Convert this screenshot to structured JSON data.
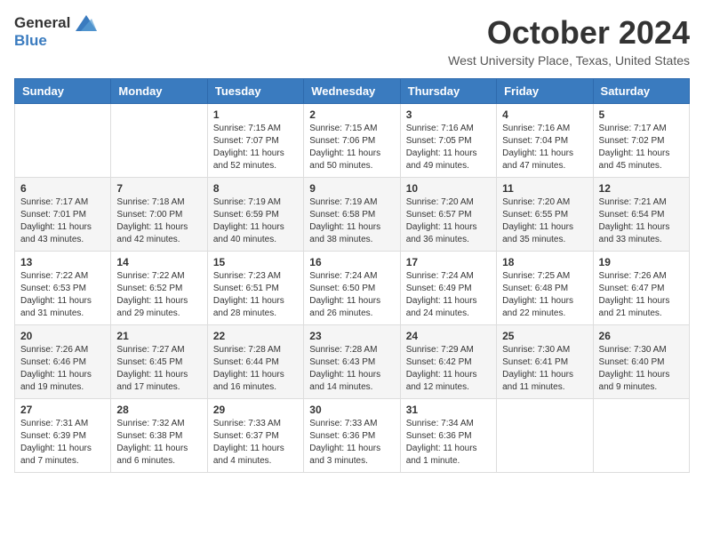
{
  "logo": {
    "general": "General",
    "blue": "Blue"
  },
  "title": "October 2024",
  "location": "West University Place, Texas, United States",
  "days_of_week": [
    "Sunday",
    "Monday",
    "Tuesday",
    "Wednesday",
    "Thursday",
    "Friday",
    "Saturday"
  ],
  "weeks": [
    [
      {
        "day": "",
        "info": ""
      },
      {
        "day": "",
        "info": ""
      },
      {
        "day": "1",
        "info": "Sunrise: 7:15 AM\nSunset: 7:07 PM\nDaylight: 11 hours and 52 minutes."
      },
      {
        "day": "2",
        "info": "Sunrise: 7:15 AM\nSunset: 7:06 PM\nDaylight: 11 hours and 50 minutes."
      },
      {
        "day": "3",
        "info": "Sunrise: 7:16 AM\nSunset: 7:05 PM\nDaylight: 11 hours and 49 minutes."
      },
      {
        "day": "4",
        "info": "Sunrise: 7:16 AM\nSunset: 7:04 PM\nDaylight: 11 hours and 47 minutes."
      },
      {
        "day": "5",
        "info": "Sunrise: 7:17 AM\nSunset: 7:02 PM\nDaylight: 11 hours and 45 minutes."
      }
    ],
    [
      {
        "day": "6",
        "info": "Sunrise: 7:17 AM\nSunset: 7:01 PM\nDaylight: 11 hours and 43 minutes."
      },
      {
        "day": "7",
        "info": "Sunrise: 7:18 AM\nSunset: 7:00 PM\nDaylight: 11 hours and 42 minutes."
      },
      {
        "day": "8",
        "info": "Sunrise: 7:19 AM\nSunset: 6:59 PM\nDaylight: 11 hours and 40 minutes."
      },
      {
        "day": "9",
        "info": "Sunrise: 7:19 AM\nSunset: 6:58 PM\nDaylight: 11 hours and 38 minutes."
      },
      {
        "day": "10",
        "info": "Sunrise: 7:20 AM\nSunset: 6:57 PM\nDaylight: 11 hours and 36 minutes."
      },
      {
        "day": "11",
        "info": "Sunrise: 7:20 AM\nSunset: 6:55 PM\nDaylight: 11 hours and 35 minutes."
      },
      {
        "day": "12",
        "info": "Sunrise: 7:21 AM\nSunset: 6:54 PM\nDaylight: 11 hours and 33 minutes."
      }
    ],
    [
      {
        "day": "13",
        "info": "Sunrise: 7:22 AM\nSunset: 6:53 PM\nDaylight: 11 hours and 31 minutes."
      },
      {
        "day": "14",
        "info": "Sunrise: 7:22 AM\nSunset: 6:52 PM\nDaylight: 11 hours and 29 minutes."
      },
      {
        "day": "15",
        "info": "Sunrise: 7:23 AM\nSunset: 6:51 PM\nDaylight: 11 hours and 28 minutes."
      },
      {
        "day": "16",
        "info": "Sunrise: 7:24 AM\nSunset: 6:50 PM\nDaylight: 11 hours and 26 minutes."
      },
      {
        "day": "17",
        "info": "Sunrise: 7:24 AM\nSunset: 6:49 PM\nDaylight: 11 hours and 24 minutes."
      },
      {
        "day": "18",
        "info": "Sunrise: 7:25 AM\nSunset: 6:48 PM\nDaylight: 11 hours and 22 minutes."
      },
      {
        "day": "19",
        "info": "Sunrise: 7:26 AM\nSunset: 6:47 PM\nDaylight: 11 hours and 21 minutes."
      }
    ],
    [
      {
        "day": "20",
        "info": "Sunrise: 7:26 AM\nSunset: 6:46 PM\nDaylight: 11 hours and 19 minutes."
      },
      {
        "day": "21",
        "info": "Sunrise: 7:27 AM\nSunset: 6:45 PM\nDaylight: 11 hours and 17 minutes."
      },
      {
        "day": "22",
        "info": "Sunrise: 7:28 AM\nSunset: 6:44 PM\nDaylight: 11 hours and 16 minutes."
      },
      {
        "day": "23",
        "info": "Sunrise: 7:28 AM\nSunset: 6:43 PM\nDaylight: 11 hours and 14 minutes."
      },
      {
        "day": "24",
        "info": "Sunrise: 7:29 AM\nSunset: 6:42 PM\nDaylight: 11 hours and 12 minutes."
      },
      {
        "day": "25",
        "info": "Sunrise: 7:30 AM\nSunset: 6:41 PM\nDaylight: 11 hours and 11 minutes."
      },
      {
        "day": "26",
        "info": "Sunrise: 7:30 AM\nSunset: 6:40 PM\nDaylight: 11 hours and 9 minutes."
      }
    ],
    [
      {
        "day": "27",
        "info": "Sunrise: 7:31 AM\nSunset: 6:39 PM\nDaylight: 11 hours and 7 minutes."
      },
      {
        "day": "28",
        "info": "Sunrise: 7:32 AM\nSunset: 6:38 PM\nDaylight: 11 hours and 6 minutes."
      },
      {
        "day": "29",
        "info": "Sunrise: 7:33 AM\nSunset: 6:37 PM\nDaylight: 11 hours and 4 minutes."
      },
      {
        "day": "30",
        "info": "Sunrise: 7:33 AM\nSunset: 6:36 PM\nDaylight: 11 hours and 3 minutes."
      },
      {
        "day": "31",
        "info": "Sunrise: 7:34 AM\nSunset: 6:36 PM\nDaylight: 11 hours and 1 minute."
      },
      {
        "day": "",
        "info": ""
      },
      {
        "day": "",
        "info": ""
      }
    ]
  ]
}
